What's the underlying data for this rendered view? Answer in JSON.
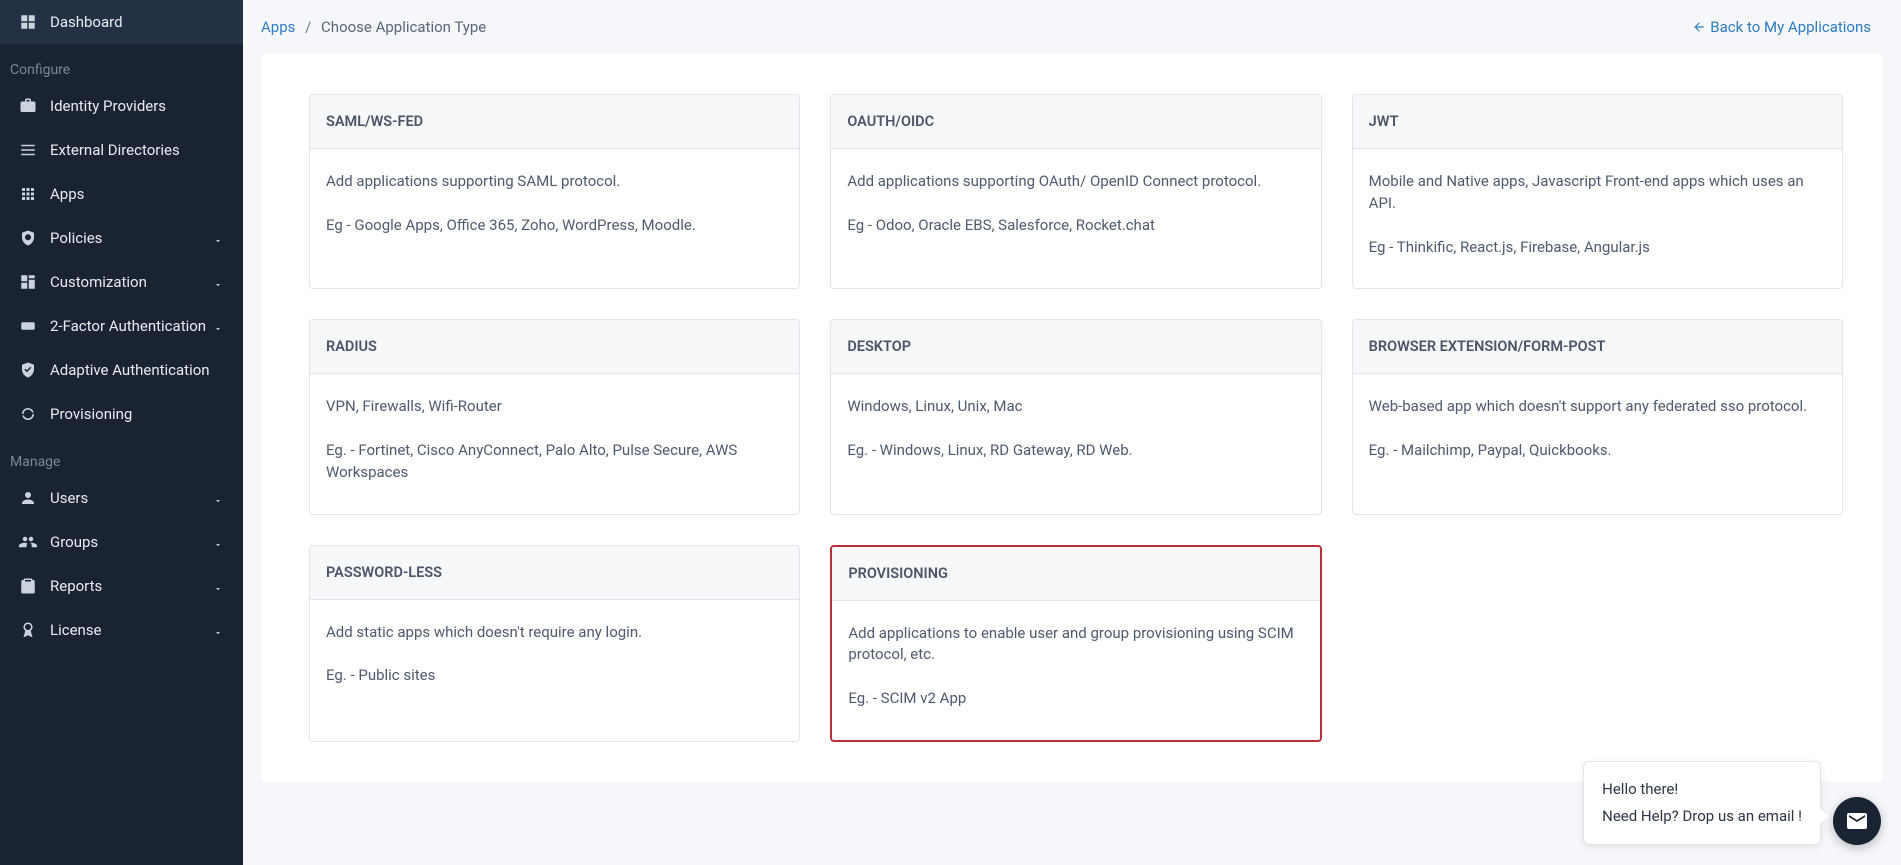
{
  "sidebar": {
    "dashboard": "Dashboard",
    "sections": {
      "configure": "Configure",
      "manage": "Manage"
    },
    "items": {
      "identity_providers": "Identity Providers",
      "external_directories": "External Directories",
      "apps": "Apps",
      "policies": "Policies",
      "customization": "Customization",
      "two_factor": "2-Factor Authentication",
      "adaptive_auth": "Adaptive Authentication",
      "provisioning": "Provisioning",
      "users": "Users",
      "groups": "Groups",
      "reports": "Reports",
      "license": "License"
    }
  },
  "breadcrumb": {
    "apps": "Apps",
    "current": "Choose Application Type"
  },
  "back_link": "Back to My Applications",
  "cards": {
    "saml": {
      "title": "SAML/WS-FED",
      "desc": "Add applications supporting SAML protocol.",
      "example": "Eg - Google Apps, Office 365, Zoho, WordPress, Moodle."
    },
    "oauth": {
      "title": "OAUTH/OIDC",
      "desc": "Add applications supporting OAuth/ OpenID Connect protocol.",
      "example": "Eg - Odoo, Oracle EBS, Salesforce, Rocket.chat"
    },
    "jwt": {
      "title": "JWT",
      "desc": "Mobile and Native apps, Javascript Front-end apps which uses an API.",
      "example": "Eg - Thinkific, React.js, Firebase, Angular.js"
    },
    "radius": {
      "title": "RADIUS",
      "desc": "VPN, Firewalls, Wifi-Router",
      "example": "Eg. - Fortinet, Cisco AnyConnect, Palo Alto, Pulse Secure, AWS Workspaces"
    },
    "desktop": {
      "title": "DESKTOP",
      "desc": "Windows, Linux, Unix, Mac",
      "example": "Eg. - Windows, Linux, RD Gateway, RD Web."
    },
    "browser_ext": {
      "title": "BROWSER EXTENSION/FORM-POST",
      "desc": "Web-based app which doesn't support any federated sso protocol.",
      "example": "Eg. - Mailchimp, Paypal, Quickbooks."
    },
    "passwordless": {
      "title": "PASSWORD-LESS",
      "desc": "Add static apps which doesn't require any login.",
      "example": "Eg. - Public sites"
    },
    "provisioning": {
      "title": "PROVISIONING",
      "desc": "Add applications to enable user and group provisioning using SCIM protocol, etc.",
      "example": "Eg. - SCIM v2 App"
    }
  },
  "chat": {
    "line1": "Hello there!",
    "line2": "Need Help? Drop us an email !"
  }
}
